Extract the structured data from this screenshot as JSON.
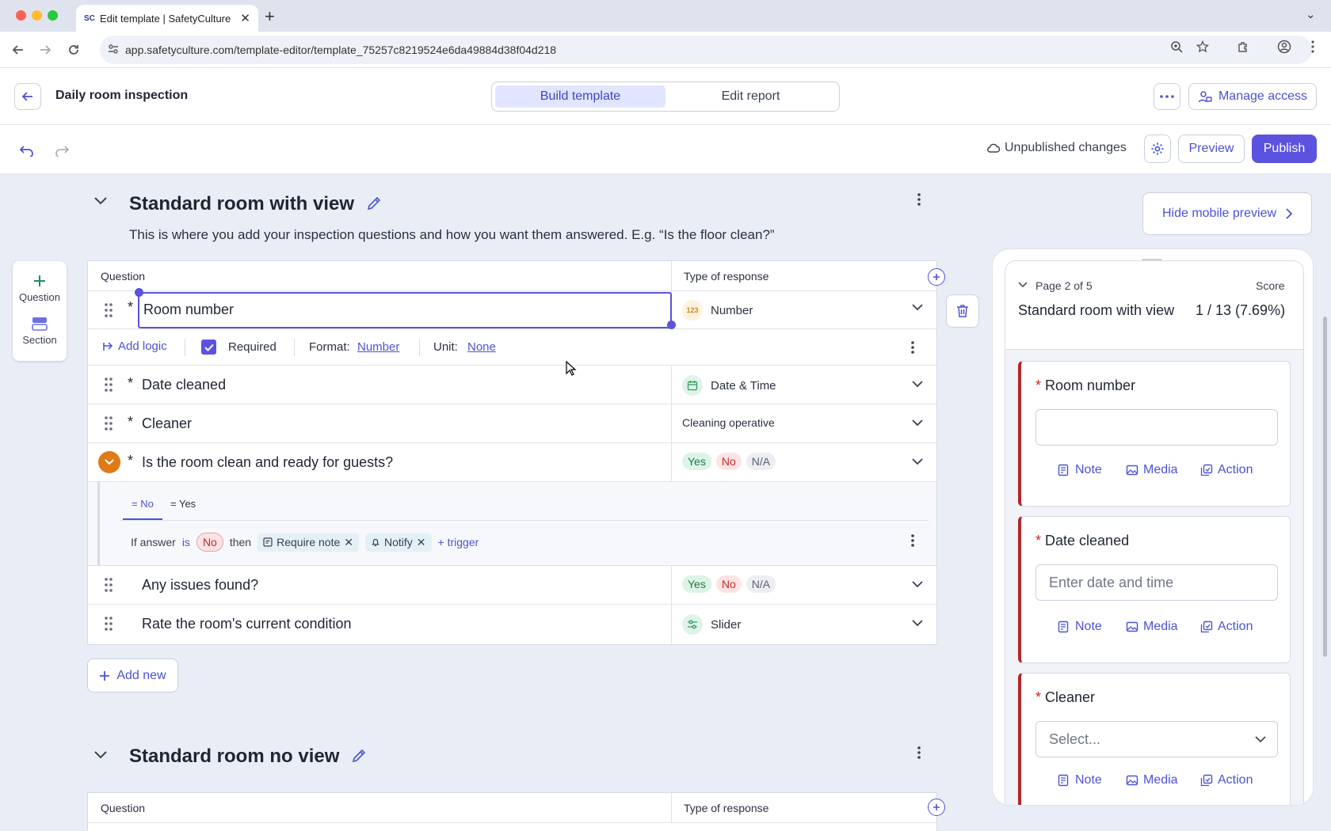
{
  "browser": {
    "tab_title": "Edit template | SafetyCulture",
    "favicon_text": "SC",
    "url": "app.safetyculture.com/template-editor/template_75257c8219524e6da49884d38f04d218"
  },
  "header": {
    "title": "Daily room inspection",
    "tabs": [
      "Build template",
      "Edit report"
    ],
    "manage_access": "Manage access"
  },
  "toolbar": {
    "status": "Unpublished changes",
    "preview": "Preview",
    "publish": "Publish"
  },
  "palette": {
    "question": "Question",
    "section": "Section"
  },
  "section1": {
    "title": "Standard room with view",
    "description": "This is where you add your inspection questions and how you want them answered. E.g. “Is the floor clean?”",
    "col_question": "Question",
    "col_response": "Type of response",
    "rows": [
      {
        "question": "Room number",
        "required": true,
        "response": "Number",
        "icon": "number-icon"
      },
      {
        "question": "Date cleaned",
        "required": true,
        "response": "Date & Time",
        "icon": "calendar-icon"
      },
      {
        "question": "Cleaner",
        "required": true,
        "response": "Cleaning operative",
        "icon": ""
      },
      {
        "question": "Is the room clean and ready for guests?",
        "required": true,
        "response": [
          "Yes",
          "No",
          "N/A"
        ]
      },
      {
        "question": "Any issues found?",
        "required": false,
        "response": [
          "Yes",
          "No",
          "N/A"
        ]
      },
      {
        "question": "Rate the room's current condition",
        "required": false,
        "response": "Slider",
        "icon": "slider-icon"
      }
    ],
    "options_bar": {
      "add_logic": "Add logic",
      "required_label": "Required",
      "format_label": "Format:",
      "format_value": "Number",
      "unit_label": "Unit:",
      "unit_value": "None"
    },
    "logic": {
      "tab_no": "= No",
      "tab_yes": "= Yes",
      "if_answer": "If answer",
      "is": "is",
      "answer": "No",
      "then": "then",
      "require_note": "Require note",
      "notify": "Notify",
      "add_trigger": "+ trigger"
    },
    "add_new": "Add new"
  },
  "section2": {
    "title": "Standard room no view",
    "col_question": "Question",
    "col_response": "Type of response"
  },
  "mobile_preview": {
    "hide_button": "Hide mobile preview",
    "page": "Page 2 of 5",
    "score_label": "Score",
    "section_title": "Standard room with view",
    "score": "1 / 13 (7.69%)",
    "cards": [
      {
        "label": "Room number",
        "input": ""
      },
      {
        "label": "Date cleaned",
        "input": "Enter date and time"
      },
      {
        "label": "Cleaner",
        "input": "Select..."
      }
    ],
    "actions": [
      "Note",
      "Media",
      "Action"
    ]
  },
  "colors": {
    "accent": "#5b52e0",
    "link": "#4b52d4",
    "required_bar": "#b3262b",
    "logic_toggle": "#e07a16"
  }
}
